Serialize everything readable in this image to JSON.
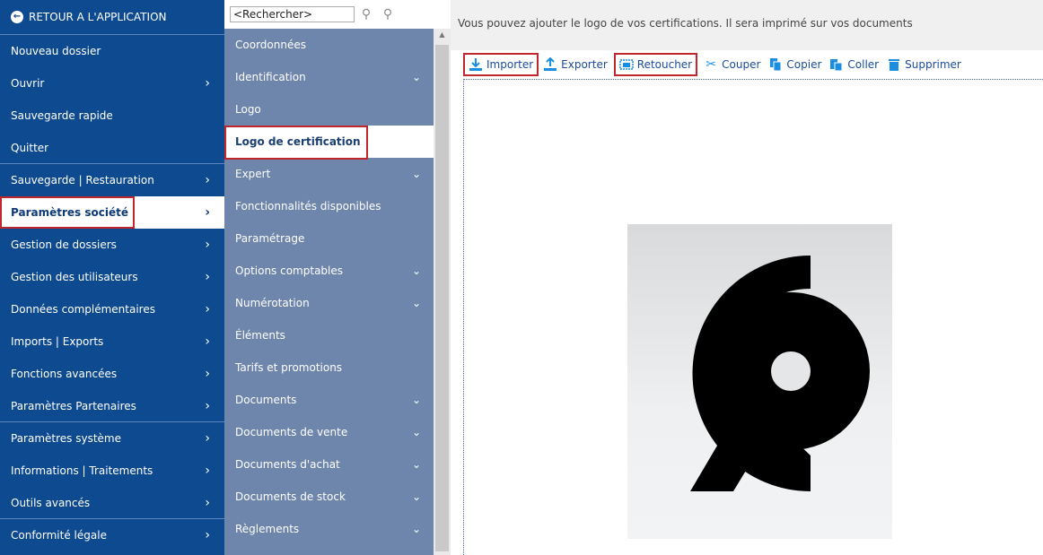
{
  "left_menu": {
    "back_label": "RETOUR A L'APPLICATION",
    "items": [
      {
        "label": "Nouveau dossier",
        "chevron": false
      },
      {
        "label": "Ouvrir",
        "chevron": true
      },
      {
        "label": "Sauvegarde rapide",
        "chevron": false
      },
      {
        "label": "Quitter",
        "chevron": false
      },
      {
        "label": "Sauvegarde | Restauration",
        "chevron": true
      },
      {
        "label": "Paramètres société",
        "chevron": true
      },
      {
        "label": "Gestion de dossiers",
        "chevron": true
      },
      {
        "label": "Gestion des utilisateurs",
        "chevron": true
      },
      {
        "label": "Données complémentaires",
        "chevron": true
      },
      {
        "label": "Imports | Exports",
        "chevron": true
      },
      {
        "label": "Fonctions avancées",
        "chevron": true
      },
      {
        "label": "Paramètres Partenaires",
        "chevron": true
      },
      {
        "label": "Paramètres système",
        "chevron": true
      },
      {
        "label": "Informations | Traitements",
        "chevron": true
      },
      {
        "label": "Outils avancés",
        "chevron": true
      },
      {
        "label": "Conformité légale",
        "chevron": true
      }
    ]
  },
  "search": {
    "placeholder": "<Rechercher>",
    "value": "<Rechercher>"
  },
  "mid_menu": {
    "items": [
      {
        "label": "Coordonnées",
        "chevron": false
      },
      {
        "label": "Identification",
        "chevron": true
      },
      {
        "label": "Logo",
        "chevron": false
      },
      {
        "label": "Logo de certification",
        "chevron": false
      },
      {
        "label": "Expert",
        "chevron": true
      },
      {
        "label": "Fonctionnalités disponibles",
        "chevron": false
      },
      {
        "label": "Paramétrage",
        "chevron": false
      },
      {
        "label": "Options comptables",
        "chevron": true
      },
      {
        "label": "Numérotation",
        "chevron": true
      },
      {
        "label": "Éléments",
        "chevron": false
      },
      {
        "label": "Tarifs et promotions",
        "chevron": false
      },
      {
        "label": "Documents",
        "chevron": true
      },
      {
        "label": "Documents de vente",
        "chevron": true
      },
      {
        "label": "Documents d'achat",
        "chevron": true
      },
      {
        "label": "Documents de stock",
        "chevron": true
      },
      {
        "label": "Règlements",
        "chevron": true
      }
    ]
  },
  "info_text": "Vous pouvez ajouter le logo de vos certifications. Il sera imprimé sur vos documents",
  "toolbar": {
    "importer": "Importer",
    "exporter": "Exporter",
    "retoucher": "Retoucher",
    "couper": "Couper",
    "copier": "Copier",
    "coller": "Coller",
    "supprimer": "Supprimer"
  },
  "colors": {
    "sidebar": "#0e4a8f",
    "mid_panel": "#6e86ac",
    "highlight": "#c0272d",
    "toolbar_text": "#1a4c9b"
  }
}
